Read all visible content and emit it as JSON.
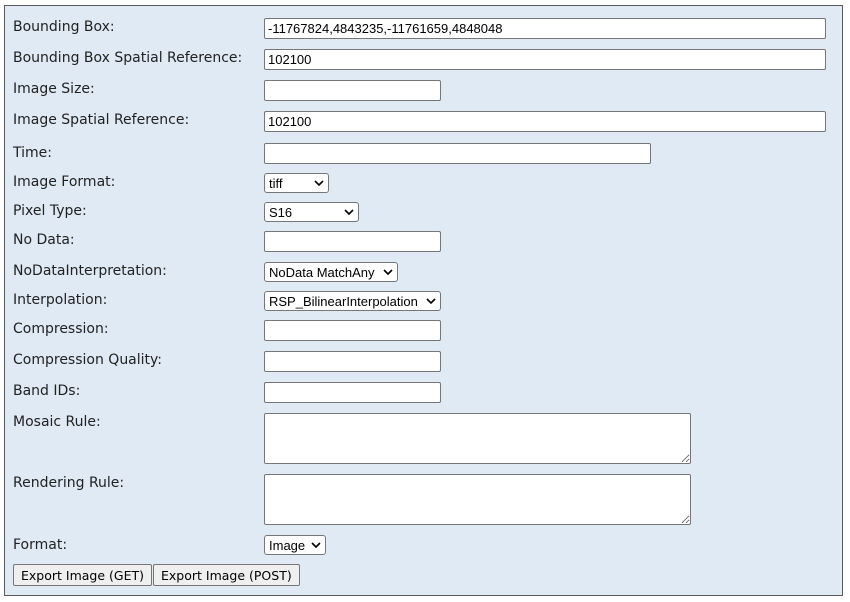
{
  "form": {
    "bounding_box": {
      "label": "Bounding Box:",
      "value": "-11767824,4843235,-11761659,4848048"
    },
    "bbox_sr": {
      "label": "Bounding Box Spatial Reference:",
      "value": "102100"
    },
    "image_size": {
      "label": "Image Size:",
      "value": ""
    },
    "image_sr": {
      "label": "Image Spatial Reference:",
      "value": "102100"
    },
    "time": {
      "label": "Time:",
      "value": ""
    },
    "image_format": {
      "label": "Image Format:",
      "value": "tiff"
    },
    "pixel_type": {
      "label": "Pixel Type:",
      "value": "S16"
    },
    "no_data": {
      "label": "No Data:",
      "value": ""
    },
    "no_data_interp": {
      "label": "NoDataInterpretation:",
      "value": "NoData MatchAny"
    },
    "interpolation": {
      "label": "Interpolation:",
      "value": "RSP_BilinearInterpolation"
    },
    "compression": {
      "label": "Compression:",
      "value": ""
    },
    "compression_quality": {
      "label": "Compression Quality:",
      "value": ""
    },
    "band_ids": {
      "label": "Band IDs:",
      "value": ""
    },
    "mosaic_rule": {
      "label": "Mosaic Rule:",
      "value": ""
    },
    "rendering_rule": {
      "label": "Rendering Rule:",
      "value": ""
    },
    "format": {
      "label": "Format:",
      "value": "Image"
    }
  },
  "buttons": {
    "export_get": "Export Image (GET)",
    "export_post": "Export Image (POST)"
  },
  "icons": {
    "dropdown": "chevron-down-icon"
  }
}
